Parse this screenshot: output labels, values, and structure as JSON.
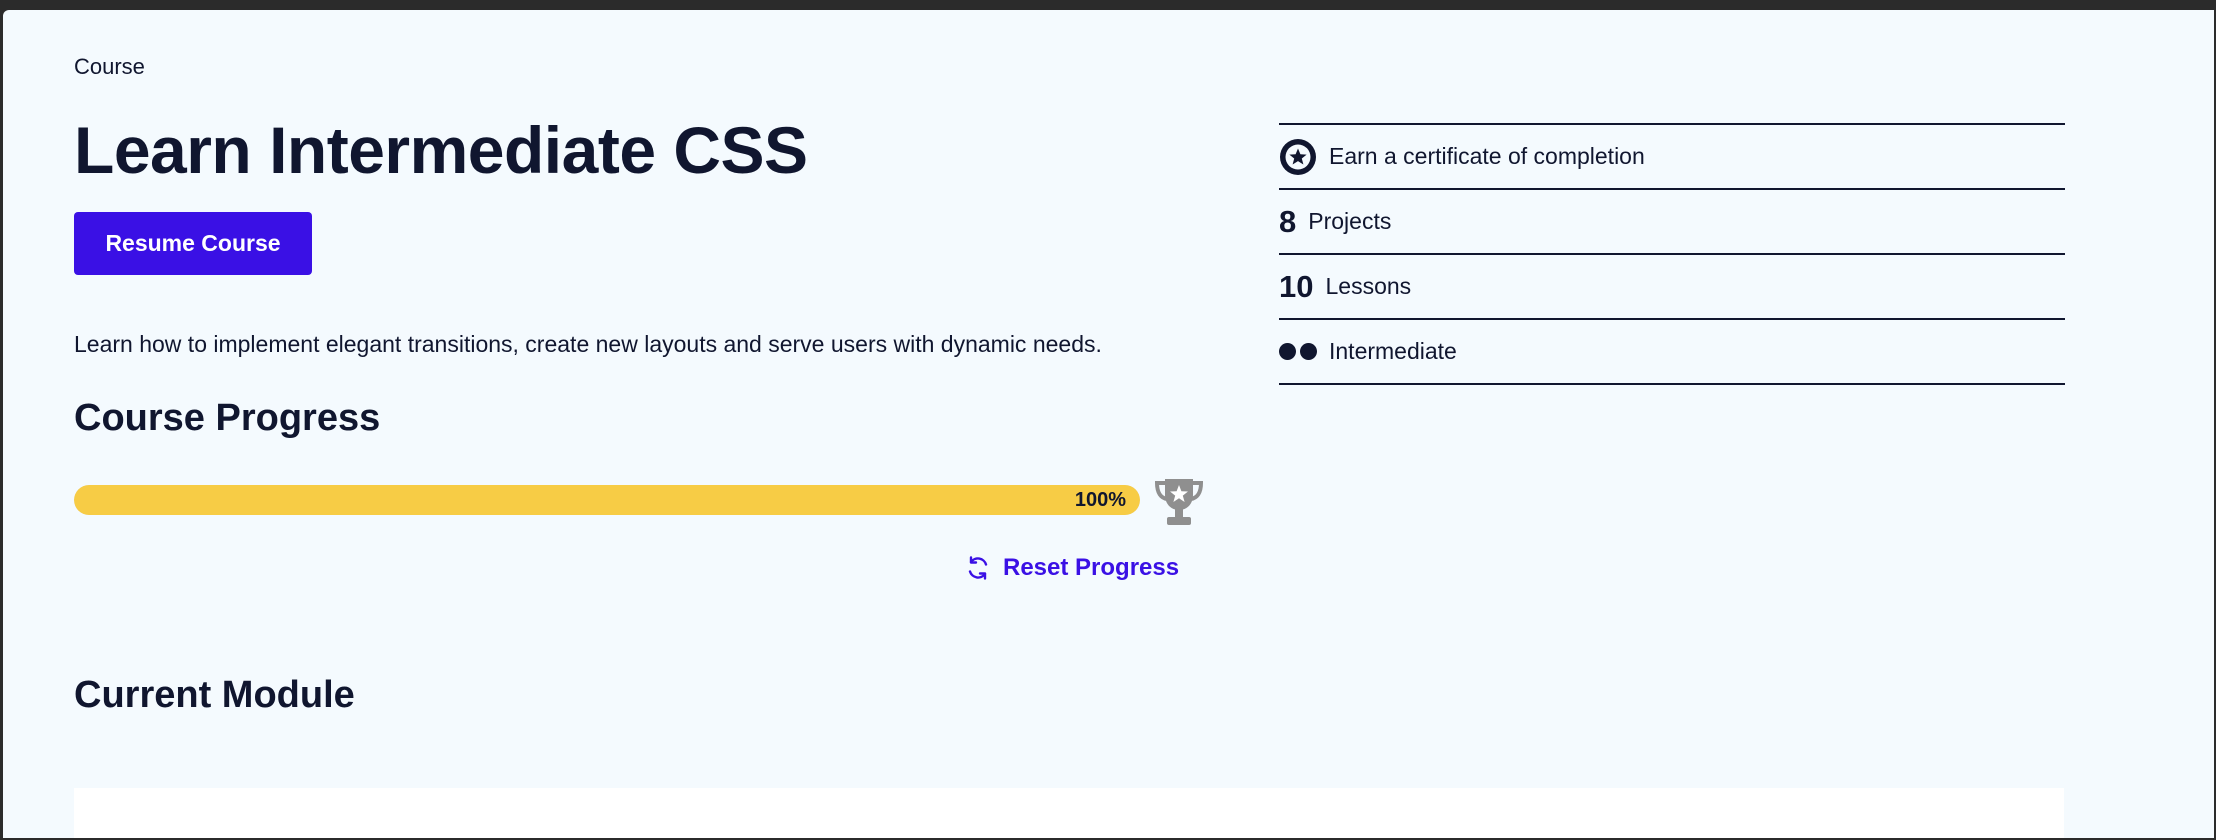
{
  "course": {
    "eyebrow": "Course",
    "title": "Learn Intermediate CSS",
    "resume_label": "Resume Course",
    "description": "Learn how to implement elegant transitions, create new layouts and serve users with dynamic needs."
  },
  "progress": {
    "heading": "Course Progress",
    "percent": 100,
    "percent_label": "100%",
    "reset_label": "Reset Progress",
    "icons": {
      "trophy": "trophy-icon",
      "reset": "refresh-icon"
    }
  },
  "current_module": {
    "heading": "Current Module"
  },
  "meta": {
    "certificate": {
      "icon": "certificate-icon",
      "label": "Earn a certificate of completion"
    },
    "projects": {
      "count": "8",
      "label": "Projects"
    },
    "lessons": {
      "count": "10",
      "label": "Lessons"
    },
    "level": {
      "icon": "difficulty-dots-icon",
      "label": "Intermediate"
    }
  },
  "colors": {
    "page_background": "#f4fafe",
    "primary": "#3a10e5",
    "progress_fill": "#f7cc45",
    "text": "#10162f",
    "trophy": "#8f8f8f"
  }
}
